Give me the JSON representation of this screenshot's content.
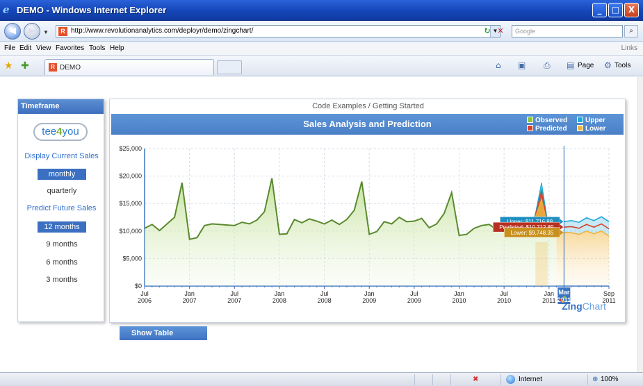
{
  "window": {
    "title": "DEMO - Windows Internet Explorer",
    "minimize": "_",
    "maximize": "□",
    "close": "X"
  },
  "address_bar": {
    "url": "http://www.revolutionanalytics.com/deployr/demo/zingchart/",
    "search_placeholder": "Google",
    "refresh_icon": "↻",
    "stop_icon": "✕",
    "search_icon": "⌕"
  },
  "menu": {
    "items": [
      "File",
      "Edit",
      "View",
      "Favorites",
      "Tools",
      "Help"
    ],
    "links": "Links"
  },
  "tabs": {
    "active_title": "DEMO",
    "page_label": "Page",
    "tools_label": "Tools"
  },
  "sidebar": {
    "header": "Timeframe",
    "logo_prefix": "tee",
    "logo_digit": "4",
    "logo_suffix": "you",
    "display_link": "Display Current Sales",
    "display_options": [
      "monthly",
      "quarterly"
    ],
    "display_selected": "monthly",
    "predict_link": "Predict Future Sales",
    "predict_options": [
      "12 months",
      "9 months",
      "6 months",
      "3 months"
    ],
    "predict_selected": "12 months"
  },
  "chart_panel": {
    "breadcrumb": "Code Examples / Getting Started",
    "show_table": "Show Table",
    "brand_zing": "Zing",
    "brand_chart": "Chart"
  },
  "colors": {
    "observed": "#8cc43c",
    "upper": "#1ea6d8",
    "predicted": "#d8402a",
    "lower": "#f0b43c",
    "line": "#5a8a2e",
    "header": "#4a7fc6"
  },
  "chart_data": {
    "type": "line",
    "title": "Sales Analysis and Prediction",
    "legend": [
      "Observed",
      "Upper",
      "Predicted",
      "Lower"
    ],
    "legend_position": "top-right",
    "ylim": [
      0,
      25000
    ],
    "y_ticks": [
      "$0",
      "$5,000",
      "$10,000",
      "$15,000",
      "$20,000",
      "$25,000"
    ],
    "x_ticks": [
      {
        "l1": "Jul",
        "l2": "2006"
      },
      {
        "l1": "Jan",
        "l2": "2007"
      },
      {
        "l1": "Jul",
        "l2": "2007"
      },
      {
        "l1": "Jan",
        "l2": "2008"
      },
      {
        "l1": "Jul",
        "l2": "2008"
      },
      {
        "l1": "Jan",
        "l2": "2009"
      },
      {
        "l1": "Jul",
        "l2": "2009"
      },
      {
        "l1": "Jan",
        "l2": "2010"
      },
      {
        "l1": "Jul",
        "l2": "2010"
      },
      {
        "l1": "Jan",
        "l2": "2011"
      },
      {
        "l1": "Sep",
        "l2": "2011"
      }
    ],
    "grid": true,
    "observed": [
      [
        "2006-07",
        10500
      ],
      [
        "2006-08",
        11200
      ],
      [
        "2006-09",
        10100
      ],
      [
        "2006-10",
        11300
      ],
      [
        "2006-11",
        12500
      ],
      [
        "2006-12",
        18800
      ],
      [
        "2007-01",
        8500
      ],
      [
        "2007-02",
        8800
      ],
      [
        "2007-03",
        11000
      ],
      [
        "2007-04",
        11300
      ],
      [
        "2007-05",
        11200
      ],
      [
        "2007-06",
        11100
      ],
      [
        "2007-07",
        11000
      ],
      [
        "2007-08",
        11600
      ],
      [
        "2007-09",
        11300
      ],
      [
        "2007-10",
        12000
      ],
      [
        "2007-11",
        13500
      ],
      [
        "2007-12",
        19600
      ],
      [
        "2008-01",
        9400
      ],
      [
        "2008-02",
        9500
      ],
      [
        "2008-03",
        12100
      ],
      [
        "2008-04",
        11500
      ],
      [
        "2008-05",
        12200
      ],
      [
        "2008-06",
        11800
      ],
      [
        "2008-07",
        11300
      ],
      [
        "2008-08",
        12000
      ],
      [
        "2008-09",
        11200
      ],
      [
        "2008-10",
        12100
      ],
      [
        "2008-11",
        13800
      ],
      [
        "2008-12",
        19000
      ],
      [
        "2009-01",
        9400
      ],
      [
        "2009-02",
        9900
      ],
      [
        "2009-03",
        11700
      ],
      [
        "2009-04",
        11300
      ],
      [
        "2009-05",
        12500
      ],
      [
        "2009-06",
        11700
      ],
      [
        "2009-07",
        11800
      ],
      [
        "2009-08",
        12300
      ],
      [
        "2009-09",
        10600
      ],
      [
        "2009-10",
        11300
      ],
      [
        "2009-11",
        13200
      ],
      [
        "2009-12",
        17000
      ],
      [
        "2010-01",
        9200
      ],
      [
        "2010-02",
        9400
      ],
      [
        "2010-03",
        10500
      ],
      [
        "2010-04",
        11000
      ],
      [
        "2010-05",
        11200
      ],
      [
        "2010-06",
        10300
      ],
      [
        "2010-07",
        10800
      ],
      [
        "2010-08",
        11100
      ],
      [
        "2010-09",
        11300
      ],
      [
        "2010-10",
        11600
      ],
      [
        "2010-11",
        11900
      ],
      [
        "2010-12",
        17500
      ],
      [
        "2011-01",
        10100
      ],
      [
        "2011-02",
        10500
      ]
    ],
    "forecast": {
      "x": [
        "2011-03",
        "2011-04",
        "2011-05",
        "2011-06",
        "2011-07",
        "2011-08",
        "2011-09"
      ],
      "upper": [
        11716.88,
        11900,
        11600,
        12400,
        11900,
        12600,
        11700
      ],
      "predicted": [
        10712.89,
        10800,
        10500,
        11200,
        10700,
        11300,
        10400
      ],
      "lower": [
        9748.35,
        9700,
        9400,
        10000,
        9500,
        10000,
        9100
      ]
    },
    "spike_2010_12": {
      "upper": 18800,
      "predicted": 17200,
      "lower": 15800
    },
    "marker_label": {
      "month": "Mar",
      "year": "2011"
    },
    "tooltips": {
      "upper": "Upper: $11,716.88",
      "predicted": "Predicted: $10,712.89",
      "lower": "Lower: $9,748.35"
    }
  },
  "status_bar": {
    "zone": "Internet",
    "zoom": "100%"
  }
}
